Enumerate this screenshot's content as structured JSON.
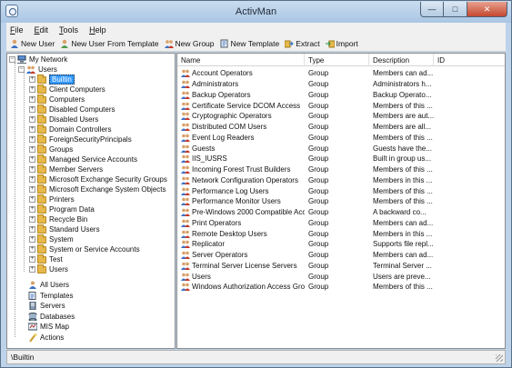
{
  "window": {
    "title": "ActivMan"
  },
  "menu": [
    {
      "label": "File",
      "key": "F",
      "rest": "ile"
    },
    {
      "label": "Edit",
      "key": "E",
      "rest": "dit"
    },
    {
      "label": "Tools",
      "key": "T",
      "rest": "ools"
    },
    {
      "label": "Help",
      "key": "H",
      "rest": "elp"
    }
  ],
  "toolbar": [
    {
      "label": "New User",
      "icon": "new-user-icon"
    },
    {
      "label": "New User From Template",
      "icon": "new-user-template-icon"
    },
    {
      "label": "New Group",
      "icon": "new-group-icon"
    },
    {
      "label": "New Template",
      "icon": "new-template-icon"
    },
    {
      "label": "Extract",
      "icon": "extract-icon"
    },
    {
      "label": "Import",
      "icon": "import-icon"
    }
  ],
  "tree": {
    "root": "My Network",
    "users_node": "Users",
    "containers": [
      "Builtin",
      "Client Computers",
      "Computers",
      "Disabled Computers",
      "Disabled Users",
      "Domain Controllers",
      "ForeignSecurityPrincipals",
      "Groups",
      "Managed Service Accounts",
      "Member Servers",
      "Microsoft Exchange Security Groups",
      "Microsoft Exchange System Objects",
      "Printers",
      "Program Data",
      "Recycle Bin",
      "Standard Users",
      "System",
      "System or Service Accounts",
      "Test",
      "Users"
    ],
    "selected": "Builtin",
    "other_nodes": [
      "All Users",
      "Templates",
      "Servers",
      "Databases",
      "MIS Map",
      "Actions"
    ]
  },
  "list": {
    "columns": [
      "Name",
      "Type",
      "Description",
      "ID"
    ],
    "rows": [
      {
        "name": "Account Operators",
        "type": "Group",
        "description": "Members can ad..."
      },
      {
        "name": "Administrators",
        "type": "Group",
        "description": "Administrators h..."
      },
      {
        "name": "Backup Operators",
        "type": "Group",
        "description": "Backup Operato..."
      },
      {
        "name": "Certificate Service DCOM Access",
        "type": "Group",
        "description": "Members of this ..."
      },
      {
        "name": "Cryptographic Operators",
        "type": "Group",
        "description": "Members are aut..."
      },
      {
        "name": "Distributed COM Users",
        "type": "Group",
        "description": "Members are all..."
      },
      {
        "name": "Event Log Readers",
        "type": "Group",
        "description": "Members of this ..."
      },
      {
        "name": "Guests",
        "type": "Group",
        "description": "Guests have the..."
      },
      {
        "name": "IIS_IUSRS",
        "type": "Group",
        "description": "Built in group us..."
      },
      {
        "name": "Incoming Forest Trust Builders",
        "type": "Group",
        "description": "Members of this ..."
      },
      {
        "name": "Network Configuration Operators",
        "type": "Group",
        "description": "Members in this ..."
      },
      {
        "name": "Performance Log Users",
        "type": "Group",
        "description": "Members of this ..."
      },
      {
        "name": "Performance Monitor Users",
        "type": "Group",
        "description": "Members of this ..."
      },
      {
        "name": "Pre-Windows 2000 Compatible Acc...",
        "type": "Group",
        "description": "A backward co..."
      },
      {
        "name": "Print Operators",
        "type": "Group",
        "description": "Members can ad..."
      },
      {
        "name": "Remote Desktop Users",
        "type": "Group",
        "description": "Members in this ..."
      },
      {
        "name": "Replicator",
        "type": "Group",
        "description": "Supports file repl..."
      },
      {
        "name": "Server Operators",
        "type": "Group",
        "description": "Members can ad..."
      },
      {
        "name": "Terminal Server License Servers",
        "type": "Group",
        "description": "Terminal Server ..."
      },
      {
        "name": "Users",
        "type": "Group",
        "description": "Users are preve..."
      },
      {
        "name": "Windows Authorization Access Gro...",
        "type": "Group",
        "description": "Members of this ..."
      }
    ]
  },
  "status": {
    "path": "\\Builtin"
  }
}
